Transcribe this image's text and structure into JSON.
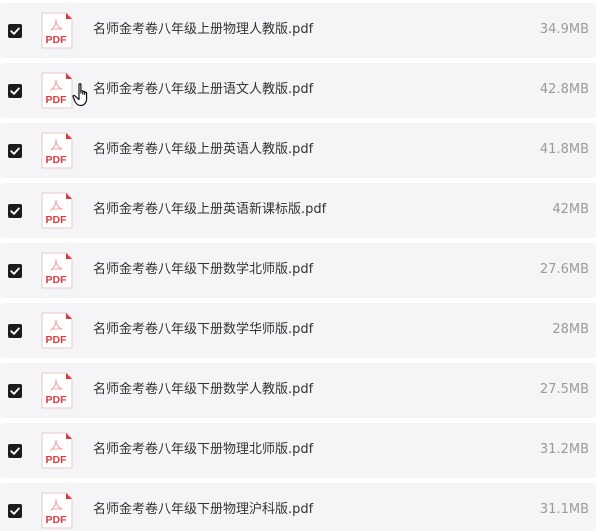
{
  "files": [
    {
      "name": "名师金考卷八年级上册物理人教版.pdf",
      "size": "34.9MB",
      "checked": true
    },
    {
      "name": "名师金考卷八年级上册语文人教版.pdf",
      "size": "42.8MB",
      "checked": true
    },
    {
      "name": "名师金考卷八年级上册英语人教版.pdf",
      "size": "41.8MB",
      "checked": true
    },
    {
      "name": "名师金考卷八年级上册英语新课标版.pdf",
      "size": "42MB",
      "checked": true
    },
    {
      "name": "名师金考卷八年级下册数学北师版.pdf",
      "size": "27.6MB",
      "checked": true
    },
    {
      "name": "名师金考卷八年级下册数学华师版.pdf",
      "size": "28MB",
      "checked": true
    },
    {
      "name": "名师金考卷八年级下册数学人教版.pdf",
      "size": "27.5MB",
      "checked": true
    },
    {
      "name": "名师金考卷八年级下册物理北师版.pdf",
      "size": "31.2MB",
      "checked": true
    },
    {
      "name": "名师金考卷八年级下册物理沪科版.pdf",
      "size": "31.1MB",
      "checked": true
    }
  ],
  "icons": {
    "file_type_icon": "pdf-file-icon",
    "file_type_label": "PDF",
    "checkbox_icon": "checkbox-checked-icon",
    "cursor_icon": "hand-pointer-icon"
  },
  "colors": {
    "row_background": "#f5f5f7",
    "checkbox": "#1c1c1e",
    "pdf_red": "#e0393e",
    "size_text": "#9b9b9b",
    "name_text": "#333333"
  }
}
